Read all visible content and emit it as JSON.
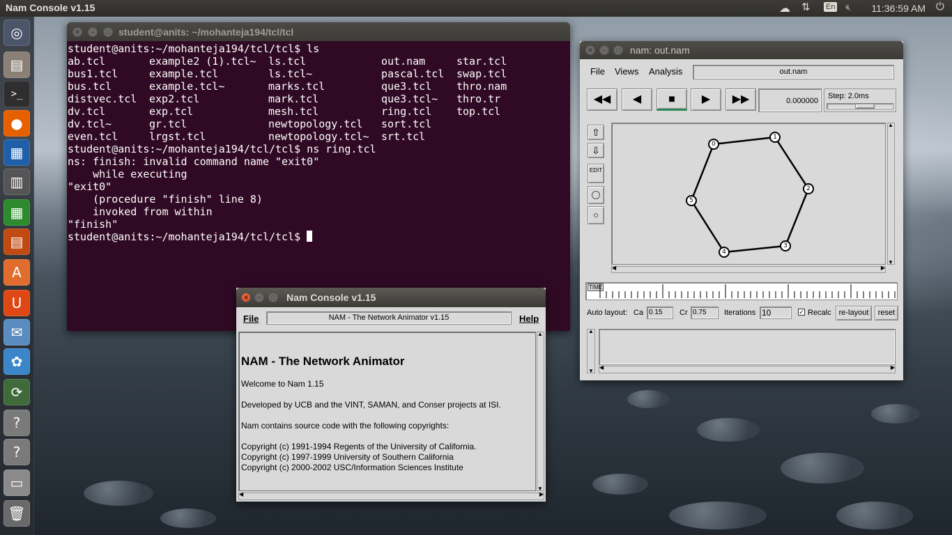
{
  "top_panel": {
    "app_title": "Nam Console v1.15",
    "keyboard_layout": "En",
    "clock": "11:36:59 AM",
    "icons": [
      "cloud-icon",
      "network-updown-icon",
      "volume-muted-icon",
      "power-icon"
    ]
  },
  "launcher": {
    "items": [
      {
        "name": "dash-icon",
        "glyph": "◎",
        "color": "#4c566a"
      },
      {
        "name": "files-icon",
        "glyph": "▤",
        "color": "#8a8076"
      },
      {
        "name": "terminal-icon",
        "glyph": ">_",
        "color": "#2e2e2e"
      },
      {
        "name": "firefox-icon",
        "glyph": "●",
        "color": "#e66000"
      },
      {
        "name": "writer-icon",
        "glyph": "▦",
        "color": "#1f5fa8"
      },
      {
        "name": "calculator-icon",
        "glyph": "▥",
        "color": "#555555"
      },
      {
        "name": "calc-icon",
        "glyph": "▦",
        "color": "#2d8a2d"
      },
      {
        "name": "impress-icon",
        "glyph": "▤",
        "color": "#c04b12"
      },
      {
        "name": "software-center-icon",
        "glyph": "A",
        "color": "#e06c2e"
      },
      {
        "name": "ubuntu-one-icon",
        "glyph": "U",
        "color": "#dd4814"
      },
      {
        "name": "mail-icon",
        "glyph": "✉",
        "color": "#5b8cc0"
      },
      {
        "name": "brain-icon",
        "glyph": "✿",
        "color": "#3a86c8"
      },
      {
        "name": "updater-icon",
        "glyph": "⟳",
        "color": "#3f6b3a"
      },
      {
        "name": "unknown-app-icon",
        "glyph": "?",
        "color": "#7a7a7a"
      },
      {
        "name": "unknown-app-icon-2",
        "glyph": "?",
        "color": "#7a7a7a"
      },
      {
        "name": "drive-icon",
        "glyph": "▭",
        "color": "#8a8a8a"
      },
      {
        "name": "trash-icon",
        "glyph": "🗑",
        "color": "#6a6a6a"
      }
    ]
  },
  "terminal": {
    "title": "student@anits: ~/mohanteja194/tcl/tcl",
    "prompt1": "student@anits:~/mohanteja194/tcl/tcl$ ls",
    "ls_rows": [
      [
        "ab.tcl",
        "example2 (1).tcl~",
        "ls.tcl",
        "out.nam",
        "star.tcl"
      ],
      [
        "bus1.tcl",
        "example.tcl",
        "ls.tcl~",
        "pascal.tcl",
        "swap.tcl"
      ],
      [
        "bus.tcl",
        "example.tcl~",
        "marks.tcl",
        "que3.tcl",
        "thro.nam"
      ],
      [
        "distvec.tcl",
        "exp2.tcl",
        "mark.tcl",
        "que3.tcl~",
        "thro.tr"
      ],
      [
        "dv.tcl",
        "exp.tcl",
        "mesh.tcl",
        "ring.tcl",
        "top.tcl"
      ],
      [
        "dv.tcl~",
        "gr.tcl",
        "newtopology.tcl",
        "sort.tcl",
        ""
      ],
      [
        "even.tcl",
        "lrgst.tcl",
        "newtopology.tcl~",
        "srt.tcl",
        ""
      ]
    ],
    "prompt2": "student@anits:~/mohanteja194/tcl/tcl$ ns ring.tcl",
    "error_lines": [
      "ns: finish: invalid command name \"exit0\"",
      "    while executing",
      "\"exit0\"",
      "    (procedure \"finish\" line 8)",
      "    invoked from within",
      "\"finish\""
    ],
    "prompt3": "student@anits:~/mohanteja194/tcl/tcl$ "
  },
  "nam_console": {
    "title": "Nam Console v1.15",
    "menu_file": "File",
    "menu_help": "Help",
    "status": "NAM - The Network Animator v1.15",
    "heading": "NAM - The Network Animator",
    "welcome": "Welcome to Nam 1.15",
    "developed": "Developed by UCB and the VINT, SAMAN, and Conser projects at ISI.",
    "contains": "Nam contains source code with the following copyrights:",
    "copyrights": [
      "Copyright (c) 1991-1994 Regents of the University of California.",
      "Copyright (c) 1997-1999 University of Southern California",
      "Copyright (c) 2000-2002 USC/Information Sciences Institute"
    ]
  },
  "nam_window": {
    "title": "nam: out.nam",
    "menus": [
      "File",
      "Views",
      "Analysis"
    ],
    "file_name": "out.nam",
    "time_value": "0.000000",
    "step_label": "Step: 2.0ms",
    "timeline_label": "TIME",
    "edit_label": "EDIT",
    "auto_layout": {
      "label": "Auto layout:",
      "ca_label": "Ca",
      "ca_value": "0.15",
      "cr_label": "Cr",
      "cr_value": "0.75",
      "iterations_label": "Iterations",
      "iterations_value": "10",
      "recalc_label": "Recalc",
      "recalc_checked": true,
      "relayout_label": "re-layout",
      "reset_label": "reset"
    },
    "nodes": [
      "0",
      "1",
      "2",
      "3",
      "4",
      "5"
    ]
  }
}
